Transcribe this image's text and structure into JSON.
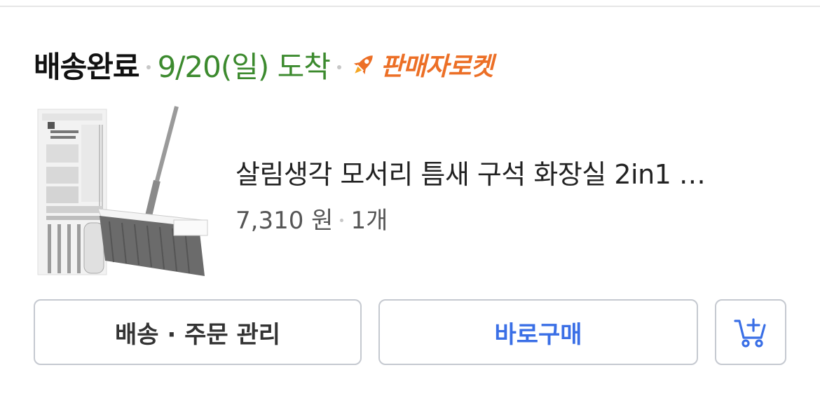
{
  "delivery": {
    "status": "배송완료",
    "arrival": "9/20(일) 도착",
    "badge_text": "판매자로켓",
    "badge_icon": "rocket-icon",
    "arrival_color": "#3c8a2e",
    "badge_color": "#ec6f26"
  },
  "product": {
    "name": "살림생각 모서리 틈새 구석 화장실 2in1 …",
    "price": "7,310 원",
    "quantity": "1개",
    "image": "broom-product-image"
  },
  "actions": {
    "manage_label": "배송 · 주문 관리",
    "buy_label": "바로구매",
    "cart_icon": "add-to-cart-icon",
    "buy_color": "#3a6fe6"
  }
}
